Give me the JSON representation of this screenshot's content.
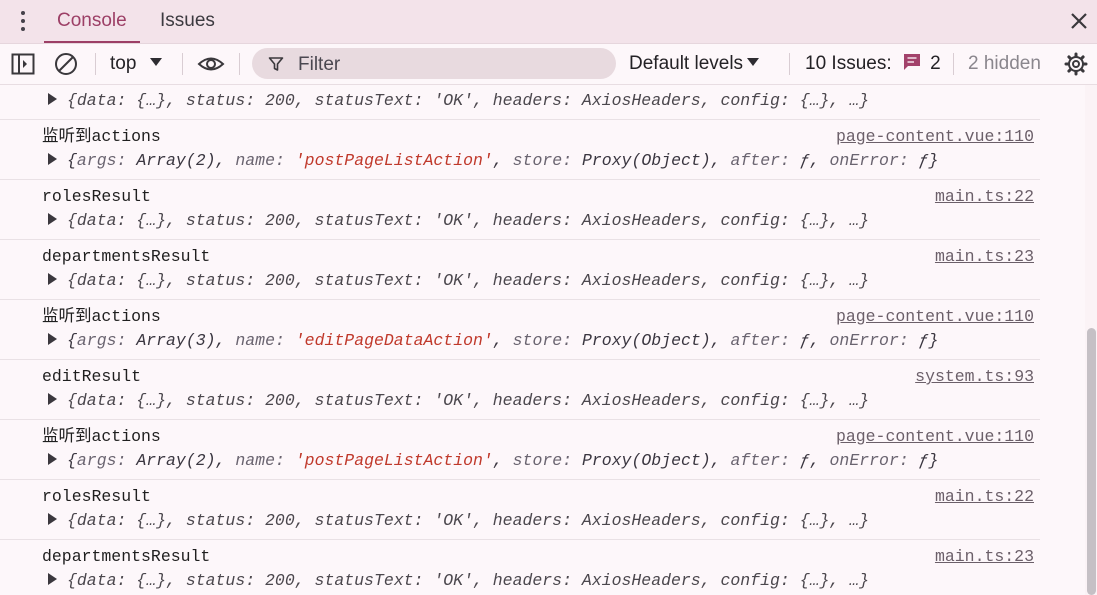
{
  "tabs": [
    {
      "label": "Console",
      "active": true
    },
    {
      "label": "Issues",
      "active": false
    }
  ],
  "toolbar": {
    "context": "top",
    "filter_placeholder": "Filter",
    "levels": "Default levels",
    "issues_label": "10 Issues:",
    "issues_count": "2",
    "hidden_label": "2 hidden"
  },
  "colors": {
    "accent": "#9c3f66",
    "string": "#c0392b",
    "number": "#1c2d8f",
    "tabbar_bg": "#f3e3ea",
    "page_bg": "#fdf7fa"
  },
  "console": {
    "partial_object": "{data: {…}, status: 200, statusText: 'OK', headers: AxiosHeaders, config: {…}, …}",
    "entries": [
      {
        "message": "监听到actions",
        "source": "page-content.vue:110",
        "kind": "actions",
        "array": "Array(2)",
        "action": "'postPageListAction'"
      },
      {
        "message": "rolesResult",
        "source": "main.ts:22",
        "kind": "axios"
      },
      {
        "message": "departmentsResult",
        "source": "main.ts:23",
        "kind": "axios"
      },
      {
        "message": "监听到actions",
        "source": "page-content.vue:110",
        "kind": "actions",
        "array": "Array(3)",
        "action": "'editPageDataAction'"
      },
      {
        "message": "editResult",
        "source": "system.ts:93",
        "kind": "axios"
      },
      {
        "message": "监听到actions",
        "source": "page-content.vue:110",
        "kind": "actions",
        "array": "Array(2)",
        "action": "'postPageListAction'"
      },
      {
        "message": "rolesResult",
        "source": "main.ts:22",
        "kind": "axios"
      },
      {
        "message": "departmentsResult",
        "source": "main.ts:23",
        "kind": "axios"
      }
    ]
  }
}
